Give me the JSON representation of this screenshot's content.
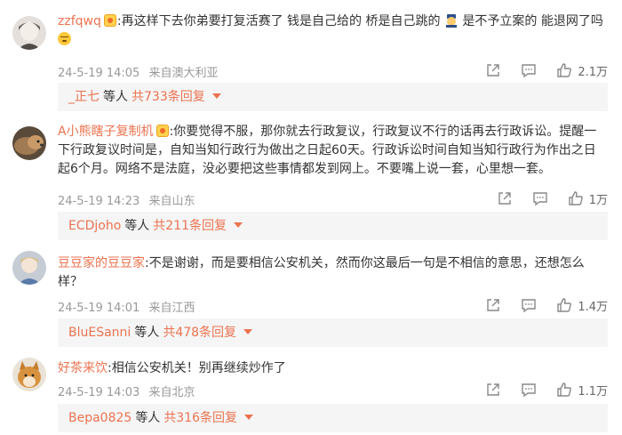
{
  "comments": [
    {
      "username": "zzfqwq",
      "text_parts": [
        ":再这样下去你弟要打复活赛了 钱是自己给的 桥是自己跳的 ",
        " 是不予立案的 能退网了吗"
      ],
      "emojis": [
        "police-officer-emoji",
        "relieved-face-emoji"
      ],
      "date": "24-5-19 14:05",
      "location": "来自澳大利亚",
      "likes": "2.1万",
      "reply_user": "_正七",
      "reply_mid": "等人",
      "reply_total": "共733条回复",
      "avatar_color": "#d9d4d0"
    },
    {
      "username": "A小熊瞎子复制机",
      "text": ":你要觉得不服，那你就去行政复议，行政复议不行的话再去行政诉讼。提醒一下行政复议时间是，自知当知行政行为做出之日起60天。行政诉讼时间自知当知行政行为作出之日起6个月。网络不是法庭，没必要把这些事情都发到网上。不要嘴上说一套，心里想一套。",
      "date": "24-5-19 14:23",
      "location": "来自山东",
      "likes": "1万",
      "reply_user": "ECDjoho",
      "reply_mid": "等人",
      "reply_total": "共211条回复",
      "avatar_color": "#8a6a4a"
    },
    {
      "username": "豆豆家的豆豆家",
      "text": ":不是谢谢，而是要相信公安机关，然而你这最后一句是不相信的意思，还想怎么样？",
      "date": "24-5-19 14:01",
      "location": "来自江西",
      "likes": "1.4万",
      "reply_user": "BluESanni",
      "reply_mid": "等人",
      "reply_total": "共478条回复",
      "avatar_color": "#b8c2cc"
    },
    {
      "username": "好茶来饮",
      "text": ":相信公安机关！别再继续炒作了",
      "date": "24-5-19 14:03",
      "location": "来自北京",
      "likes": "1.1万",
      "reply_user": "Bepa0825",
      "reply_mid": "等人",
      "reply_total": "共316条回复",
      "avatar_color": "#c98a4a"
    }
  ],
  "colors": {
    "username": "#eb7350",
    "meta": "#999999",
    "reply_bg": "#f5f5f5"
  }
}
